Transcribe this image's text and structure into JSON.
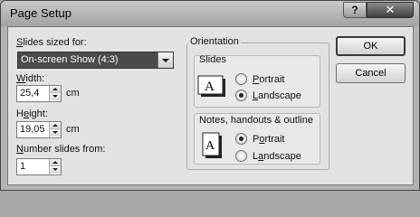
{
  "window": {
    "title": "Page Setup",
    "help_label": "?",
    "close_label": "✕"
  },
  "slides_sized_for": {
    "label_accel": "S",
    "label_rest": "lides sized for:",
    "value": "On-screen Show (4:3)"
  },
  "width": {
    "label_accel": "W",
    "label_rest": "idth:",
    "value": "25,4",
    "unit": "cm"
  },
  "height": {
    "label_prefix": "H",
    "label_accel": "e",
    "label_rest": "ight:",
    "value": "19,05",
    "unit": "cm"
  },
  "number_slides_from": {
    "label_accel": "N",
    "label_rest": "umber slides from:",
    "value": "1"
  },
  "orientation": {
    "legend": "Orientation",
    "slides": {
      "label": "Slides",
      "icon_letter": "A",
      "portrait_accel": "P",
      "portrait_rest": "ortrait",
      "landscape_accel": "L",
      "landscape_rest": "andscape",
      "selected": "landscape"
    },
    "notes": {
      "label": "Notes, handouts & outline",
      "icon_letter": "A",
      "portrait_prefix": "P",
      "portrait_accel": "o",
      "portrait_rest": "rtrait",
      "landscape_prefix": "L",
      "landscape_accel": "a",
      "landscape_rest": "ndscape",
      "selected": "portrait"
    }
  },
  "buttons": {
    "ok": "OK",
    "cancel": "Cancel"
  }
}
